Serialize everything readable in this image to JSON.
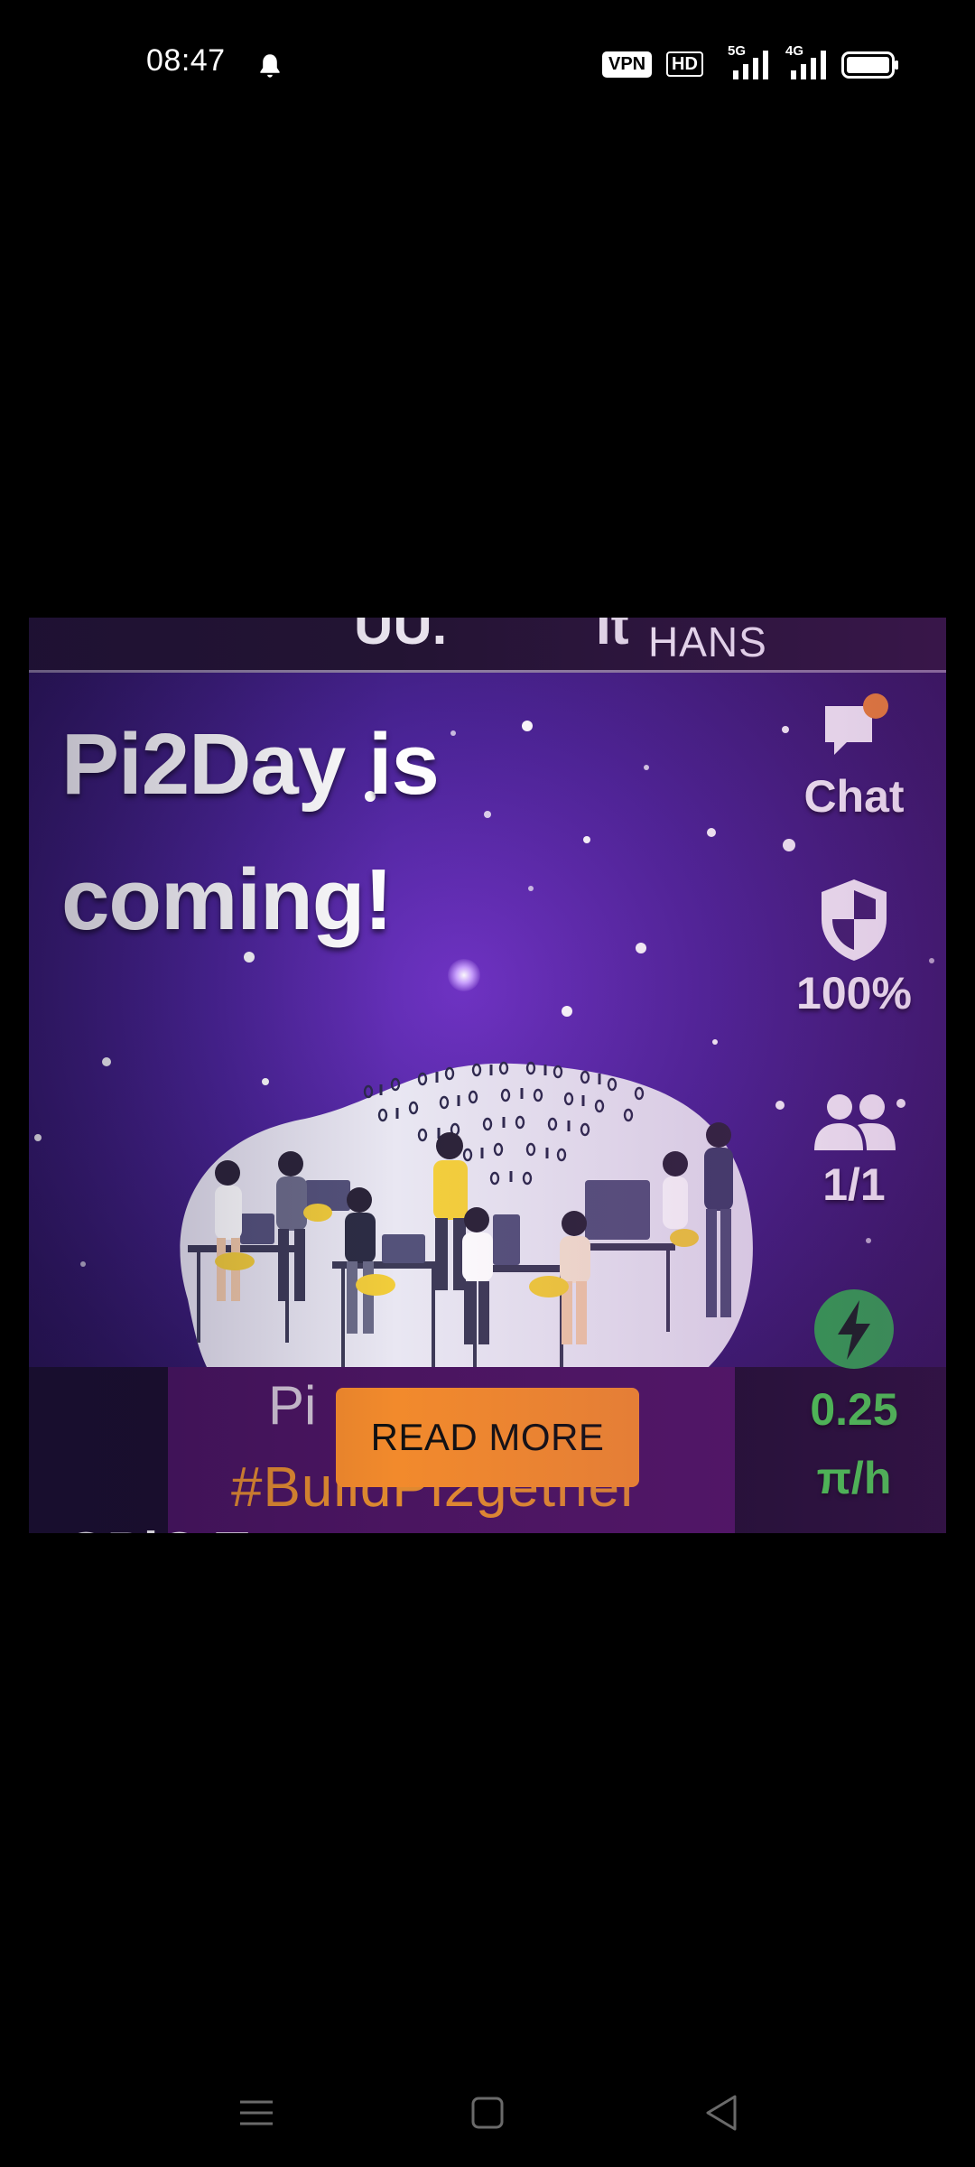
{
  "status_bar": {
    "time": "08:47",
    "vpn_badge": "VPN",
    "hd_badge": "HD",
    "network_1": "5G",
    "network_2": "4G"
  },
  "banner": {
    "top_strip_text": "HANS",
    "top_strip_fragment_1": "UU.",
    "top_strip_fragment_2": "It",
    "headline_line1": "Pi2Day is",
    "headline_line2": "coming!",
    "bottom_strip_line1": "Pi",
    "bottom_strip_line2": "#BuildPi2gether",
    "bottom_strip_line3": "OPiO    T"
  },
  "read_more_label": "READ MORE",
  "side_controls": {
    "chat_label": "Chat",
    "security_percent": "100%",
    "team_count": "1/1",
    "mining_rate": "0.25",
    "mining_unit": "π/h"
  },
  "colors": {
    "accent_orange": "#f28a2c",
    "mining_green": "#44d64a",
    "notification_dot": "#f28a2c"
  }
}
